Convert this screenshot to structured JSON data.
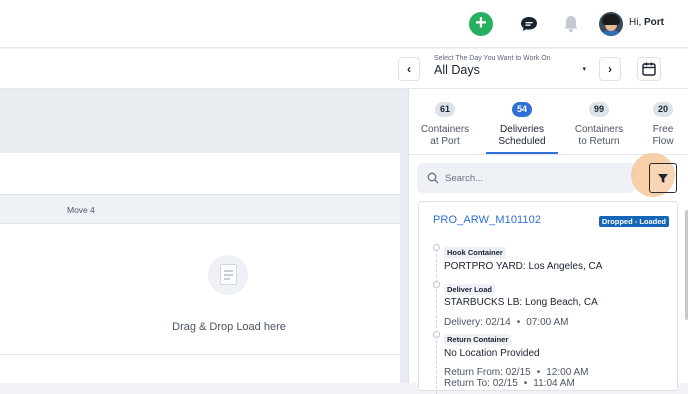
{
  "header": {
    "greeting_prefix": "Hi,",
    "user_name": "Port",
    "add_label": "+",
    "icons": [
      "plus-icon",
      "chat-icon",
      "bell-icon",
      "avatar"
    ]
  },
  "date_nav": {
    "prev_label": "‹",
    "next_label": "›",
    "hint": "Select The Day You Want to Work On",
    "value": "All Days",
    "caret": "▾"
  },
  "board": {
    "column_label": "Move 4",
    "drop_text": "Drag & Drop Load here"
  },
  "tabs": [
    {
      "count": "61",
      "line1": "Containers",
      "line2": "at Port",
      "active": false
    },
    {
      "count": "54",
      "line1": "Deliveries",
      "line2": "Scheduled",
      "active": true
    },
    {
      "count": "99",
      "line1": "Containers",
      "line2": "to Return",
      "active": false
    },
    {
      "count": "20",
      "line1": "Free",
      "line2": "Flow",
      "active": false
    }
  ],
  "search": {
    "placeholder": "Search..."
  },
  "load_card": {
    "id": "PRO_ARW_M101102",
    "status": "Dropped - Loaded",
    "stops": [
      {
        "tag": "Hook Container",
        "location": "PORTPRO YARD: Los Angeles, CA"
      },
      {
        "tag": "Deliver Load",
        "location": "STARBUCKS LB: Long Beach, CA",
        "meta_label": "Delivery: 02/14",
        "meta_time": "07:00 AM"
      },
      {
        "tag": "Return Container",
        "location": "No Location Provided",
        "meta_label": "Return From: 02/15",
        "meta_time": "12:00 AM",
        "meta2_label": "Return To: 02/15",
        "meta2_time": "11:04 AM"
      }
    ]
  },
  "colors": {
    "accent": "#2f6fd6",
    "add_green": "#27ae60",
    "status_blue": "#1565b8",
    "filter_highlight": "#f6c79a"
  }
}
